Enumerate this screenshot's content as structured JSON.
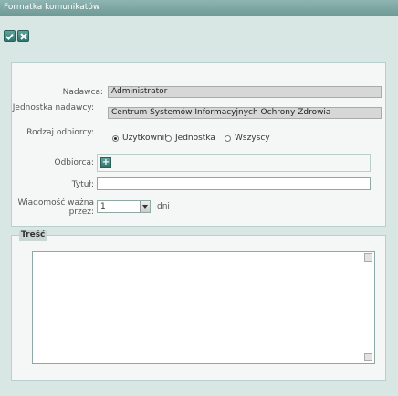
{
  "window": {
    "title": "Formatka komunikatów"
  },
  "toolbar": {
    "save_icon": "check-icon",
    "cancel_icon": "close-icon"
  },
  "form": {
    "sender": {
      "label": "Nadawca:",
      "value": "Administrator"
    },
    "sender_unit": {
      "label": "Jednostka nadawcy:",
      "value": "Centrum Systemów Informacyjnych Ochrony Zdrowia"
    },
    "recipient_type": {
      "label": "Rodzaj odbiorcy:",
      "options": [
        "Użytkownik",
        "Jednostka",
        "Wszyscy"
      ],
      "selected": "Użytkownik"
    },
    "recipient": {
      "label": "Odbiorca:",
      "add_icon": "plus-icon"
    },
    "title": {
      "label": "Tytuł:",
      "value": ""
    },
    "valid_for": {
      "label": "Wiadomość ważna przez:",
      "value": "1",
      "unit": "dni"
    }
  },
  "content": {
    "legend": "Treść",
    "value": ""
  },
  "colors": {
    "accent": "#2f756f",
    "titlebar": "#7da5a1",
    "background": "#d9e7e4"
  }
}
